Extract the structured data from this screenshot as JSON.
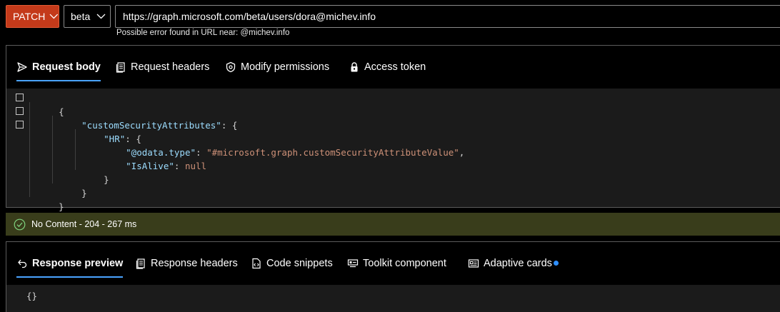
{
  "query": {
    "method": "PATCH",
    "version": "beta",
    "url": "https://graph.microsoft.com/beta/users/dora@michev.info",
    "url_error": "Possible error found in URL near: @michev.info"
  },
  "request_tabs": [
    {
      "label": "Request body",
      "icon": "send-icon"
    },
    {
      "label": "Request headers",
      "icon": "document-icon"
    },
    {
      "label": "Modify permissions",
      "icon": "shield-icon"
    },
    {
      "label": "Access token",
      "icon": "lock-icon"
    }
  ],
  "request_body": {
    "open_brace": "{",
    "key1": "\"customSecurityAttributes\"",
    "colon_open1": ": {",
    "key2": "\"HR\"",
    "colon_open2": ": {",
    "key3": "\"@odata.type\"",
    "colon3": ": ",
    "val3": "\"#microsoft.graph.customSecurityAttributeValue\"",
    "comma3": ",",
    "key4": "\"IsAlive\"",
    "colon4": ": ",
    "val4": "null",
    "close3": "}",
    "close2": "}",
    "close1": "}"
  },
  "status": {
    "text": "No Content - 204 - 267 ms",
    "icon": "check-circle-icon",
    "color": "#393d1b"
  },
  "response_tabs": [
    {
      "label": "Response preview",
      "icon": "undo-icon"
    },
    {
      "label": "Response headers",
      "icon": "document-icon"
    },
    {
      "label": "Code snippets",
      "icon": "code-file-icon"
    },
    {
      "label": "Toolkit component",
      "icon": "toolkit-icon"
    },
    {
      "label": "Adaptive cards",
      "icon": "card-icon"
    }
  ],
  "response_body": "{}",
  "colors": {
    "method": "#c43a1a",
    "tab_underline": "#4aa3ff",
    "notification_dot": "#2f8fff"
  }
}
